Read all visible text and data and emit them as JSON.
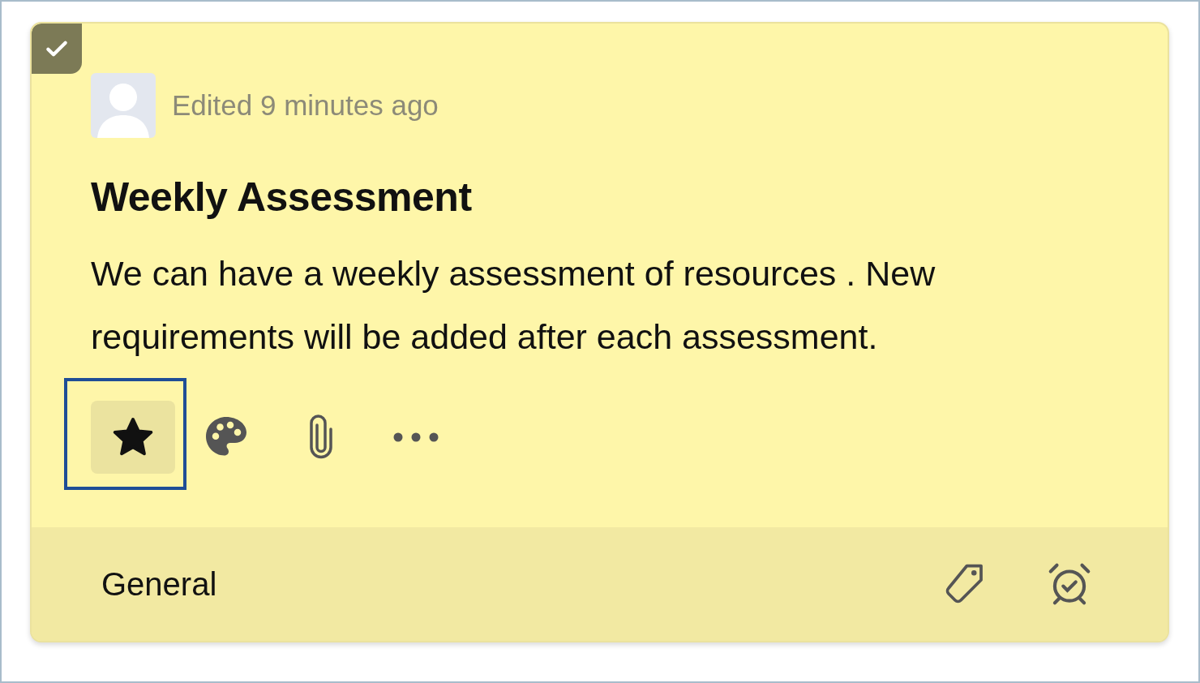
{
  "card": {
    "checked": true,
    "edited": "Edited 9 minutes ago",
    "title": "Weekly Assessment",
    "body": "We can have a weekly assessment of resources . New requirements will be added after each assessment.",
    "actions": [
      {
        "kind": "star",
        "filled": true,
        "focused": true
      },
      {
        "kind": "palette",
        "filled": false,
        "focused": false
      },
      {
        "kind": "attach",
        "filled": false,
        "focused": false
      },
      {
        "kind": "more",
        "filled": false,
        "focused": false
      }
    ],
    "footer": {
      "category": "General",
      "icons": [
        {
          "kind": "tag"
        },
        {
          "kind": "alarm"
        }
      ]
    }
  }
}
